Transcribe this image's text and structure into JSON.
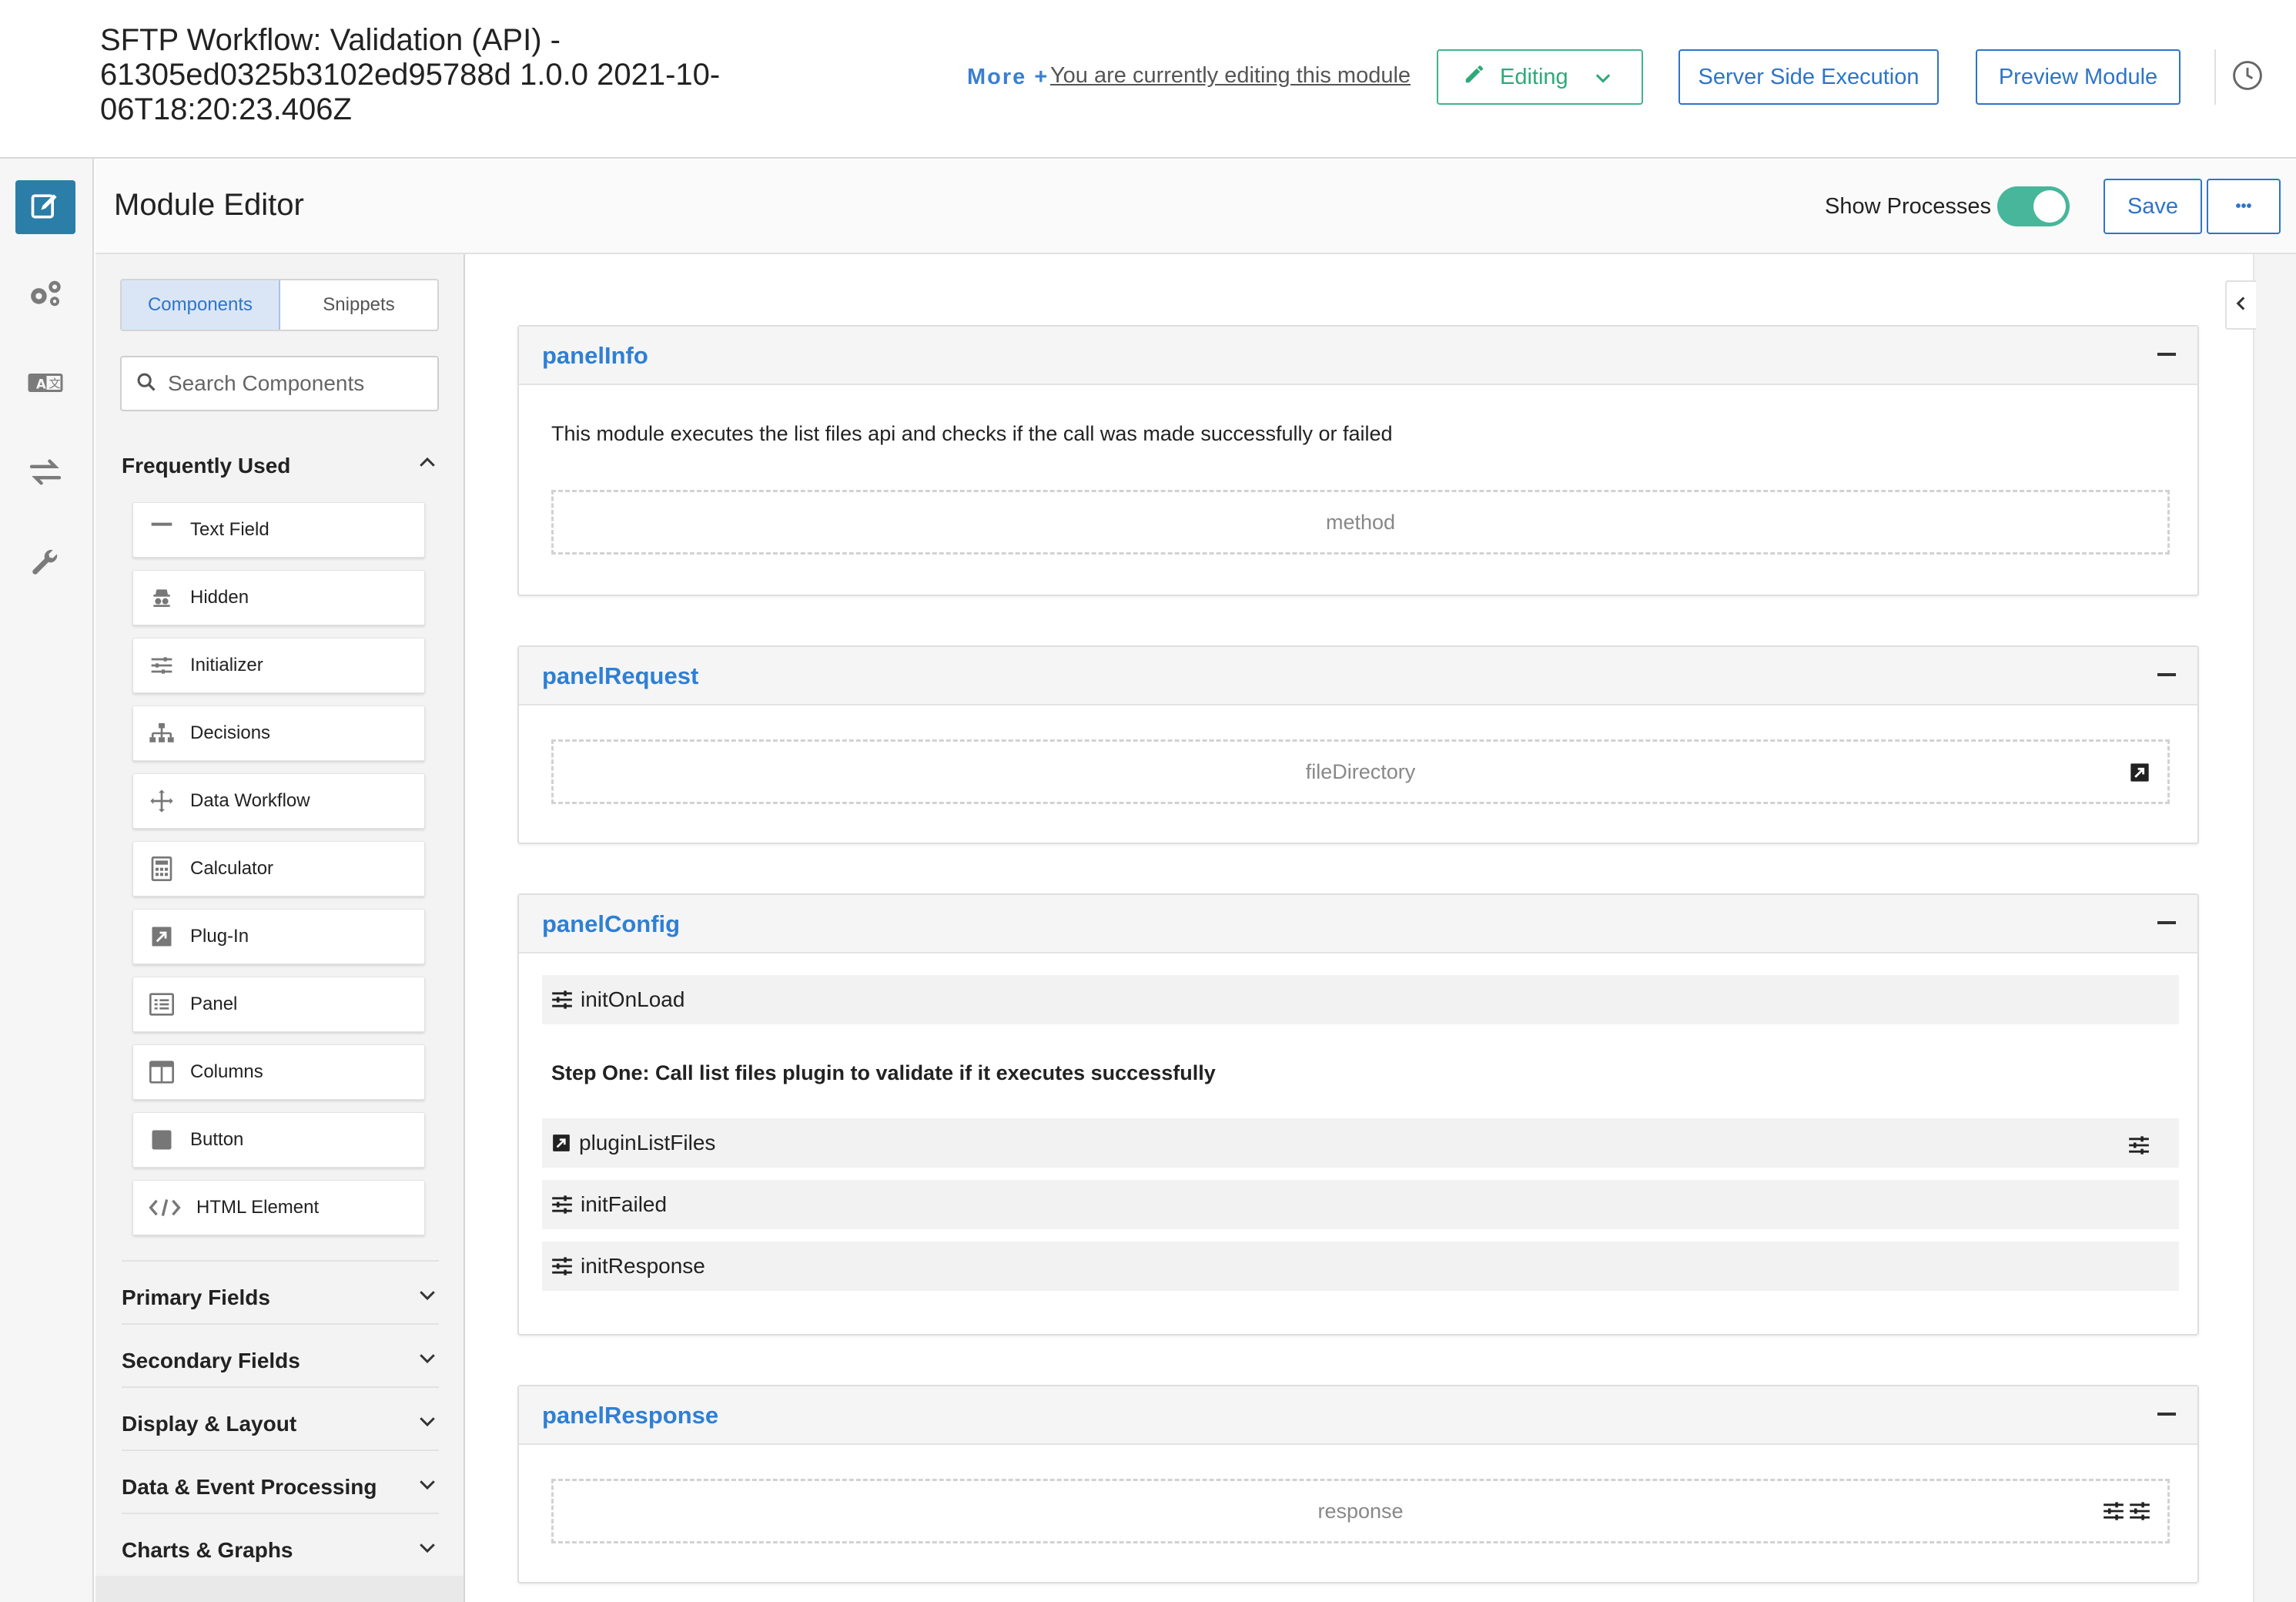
{
  "header": {
    "title": "SFTP Workflow: Validation (API) - 61305ed0325b3102ed95788d 1.0.0 2021-10-06T18:20:23.406Z",
    "more_label": "More +",
    "editing_notice": "You are currently editing this module",
    "editing_dropdown_label": "Editing",
    "server_side_label": "Server Side Execution",
    "preview_label": "Preview Module"
  },
  "editor": {
    "title": "Module Editor",
    "show_processes_label": "Show Processes",
    "show_processes_on": true,
    "save_label": "Save",
    "more_glyph": "•••"
  },
  "sidebar": {
    "tabs": [
      "Components",
      "Snippets"
    ],
    "search_placeholder": "Search Components",
    "frequently_used_label": "Frequently Used",
    "items": [
      {
        "label": "Text Field",
        "icon": "text-field-icon"
      },
      {
        "label": "Hidden",
        "icon": "hidden-icon"
      },
      {
        "label": "Initializer",
        "icon": "initializer-icon"
      },
      {
        "label": "Decisions",
        "icon": "decisions-icon"
      },
      {
        "label": "Data Workflow",
        "icon": "data-workflow-icon"
      },
      {
        "label": "Calculator",
        "icon": "calculator-icon"
      },
      {
        "label": "Plug-In",
        "icon": "plugin-icon"
      },
      {
        "label": "Panel",
        "icon": "panel-icon"
      },
      {
        "label": "Columns",
        "icon": "columns-icon"
      },
      {
        "label": "Button",
        "icon": "button-icon"
      },
      {
        "label": "HTML Element",
        "icon": "code-icon"
      }
    ],
    "sections": [
      "Primary Fields",
      "Secondary Fields",
      "Display & Layout",
      "Data & Event Processing",
      "Charts & Graphs"
    ]
  },
  "panels": {
    "info": {
      "title": "panelInfo",
      "description": "This module executes the list files api and checks if the call was made successfully or failed",
      "field": "method"
    },
    "request": {
      "title": "panelRequest",
      "field": "fileDirectory"
    },
    "config": {
      "title": "panelConfig",
      "init_on_load": "initOnLoad",
      "step_text": "Step One: Call list files plugin to validate if it executes successfully",
      "plugin_list_files": "pluginListFiles",
      "init_failed": "initFailed",
      "init_response": "initResponse"
    },
    "response": {
      "title": "panelResponse",
      "field": "response"
    }
  },
  "colors": {
    "accent": "#2f74c8",
    "editing_green": "#3fb58a",
    "toggle_on": "#47b69a",
    "rail_active": "#2a7ea8",
    "panel_title": "#2f7fd4"
  }
}
